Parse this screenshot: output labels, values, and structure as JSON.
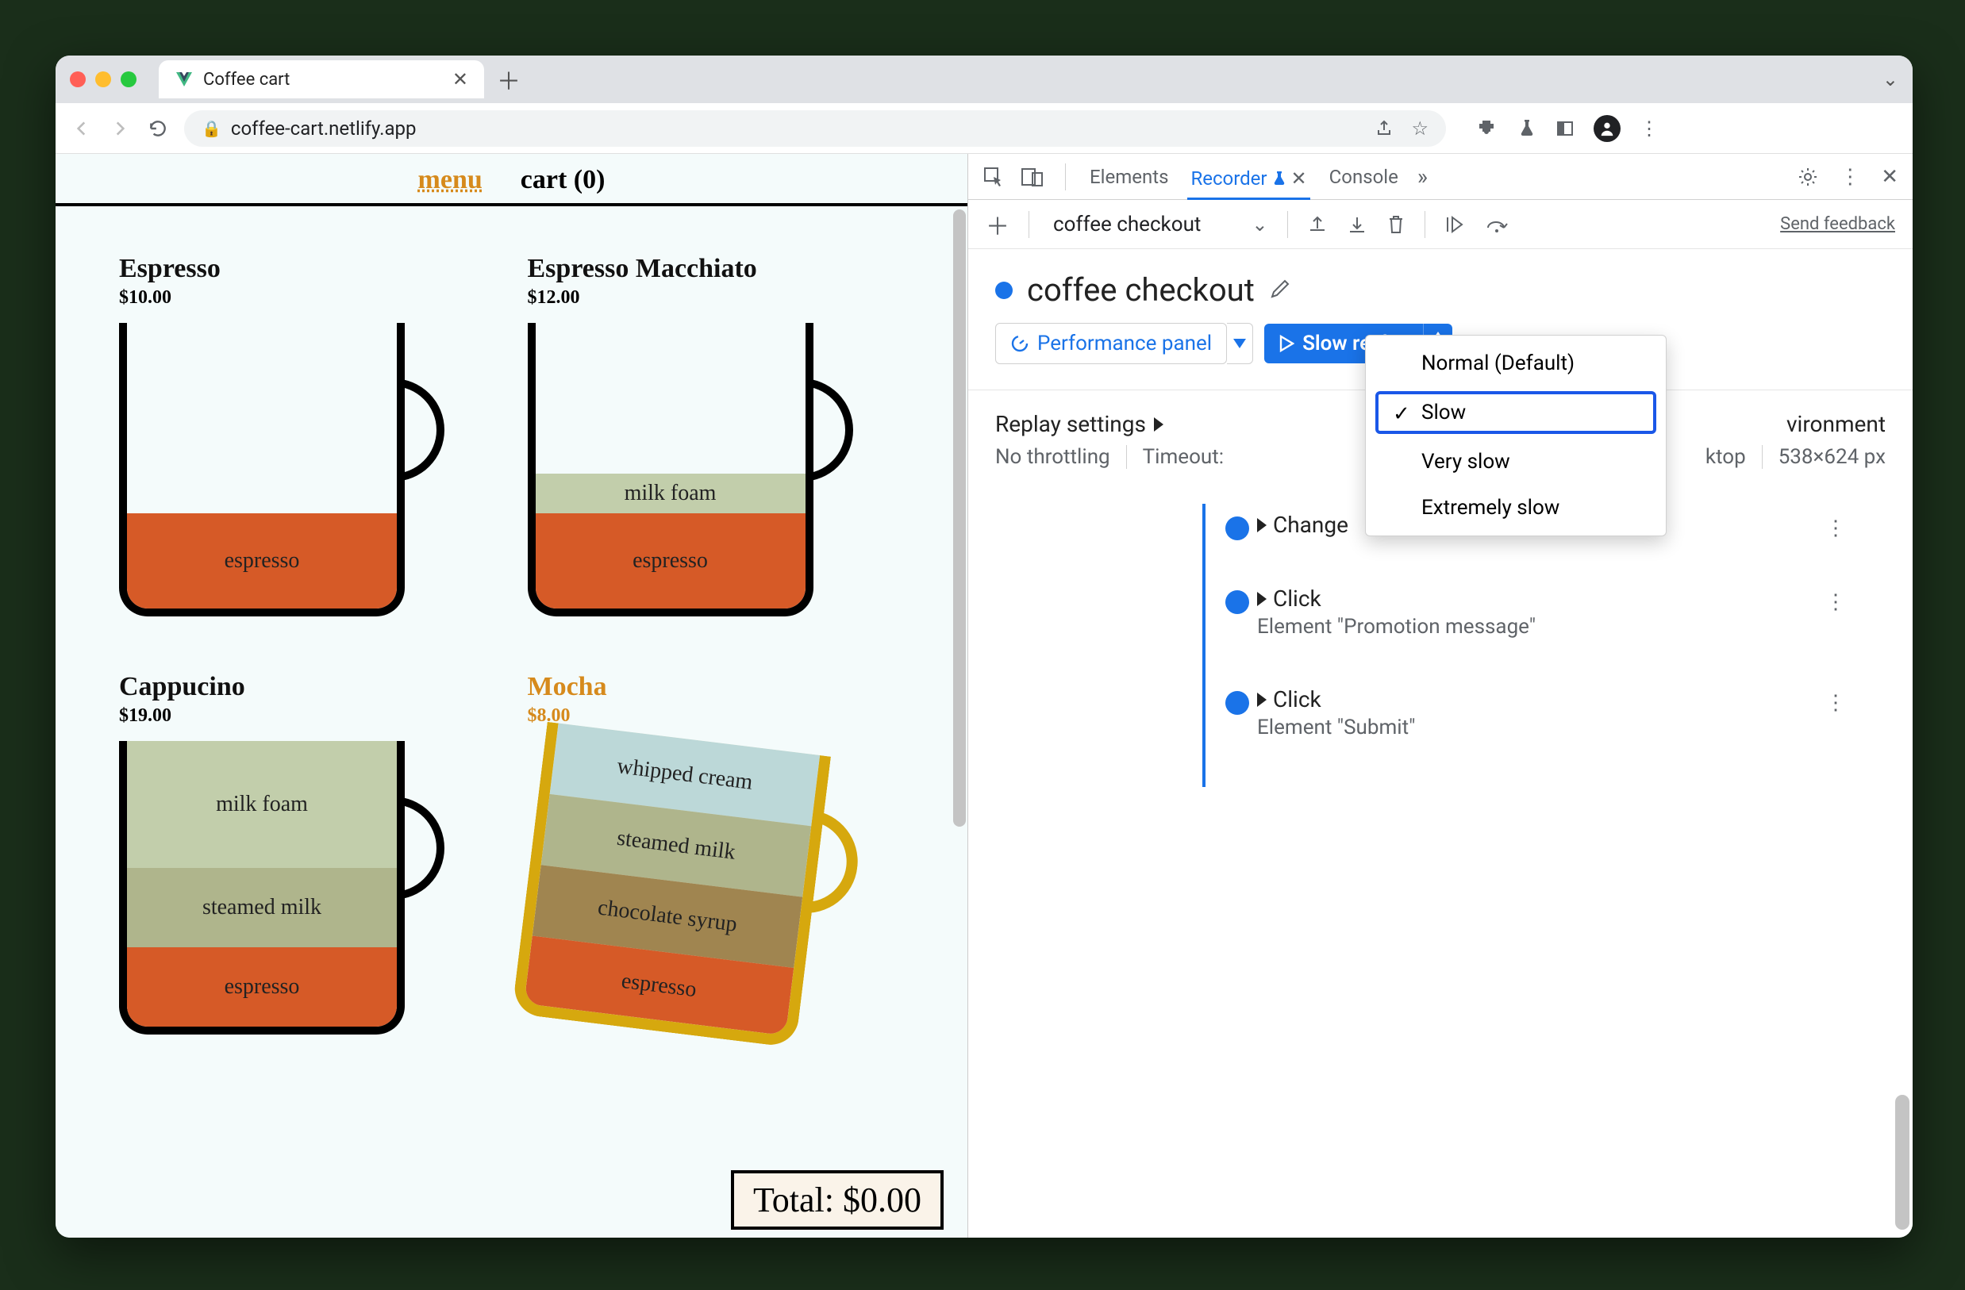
{
  "browser": {
    "tab_title": "Coffee cart",
    "url": "coffee-cart.netlify.app"
  },
  "page": {
    "nav_menu": "menu",
    "nav_cart": "cart (0)",
    "products": [
      {
        "name": "Espresso",
        "price": "$10.00",
        "highlight": false
      },
      {
        "name": "Espresso Macchiato",
        "price": "$12.00",
        "highlight": false
      },
      {
        "name": "Cappucino",
        "price": "$19.00",
        "highlight": false
      },
      {
        "name": "Mocha",
        "price": "$8.00",
        "highlight": true
      }
    ],
    "layers": {
      "espresso": "espresso",
      "milkfoam": "milk foam",
      "steamed": "steamed milk",
      "choco": "chocolate syrup",
      "whipped": "whipped cream"
    },
    "total": "Total: $0.00"
  },
  "devtools": {
    "tabs": {
      "elements": "Elements",
      "recorder": "Recorder",
      "console": "Console"
    },
    "toolbar": {
      "recording_name": "coffee checkout",
      "feedback": "Send feedback"
    },
    "recording_title": "coffee checkout",
    "perf_panel": "Performance panel",
    "replay_button": "Slow replay",
    "replay_menu": [
      "Normal (Default)",
      "Slow",
      "Very slow",
      "Extremely slow"
    ],
    "replay_selected_index": 1,
    "settings_label": "Replay settings",
    "environment_label": "vironment",
    "no_throttling": "No throttling",
    "timeout": "Timeout:",
    "viewport_kind": "ktop",
    "viewport_size": "538×624 px",
    "steps": [
      {
        "title": "Change",
        "sub": ""
      },
      {
        "title": "Click",
        "sub": "Element \"Promotion message\""
      },
      {
        "title": "Click",
        "sub": "Element \"Submit\""
      }
    ]
  }
}
